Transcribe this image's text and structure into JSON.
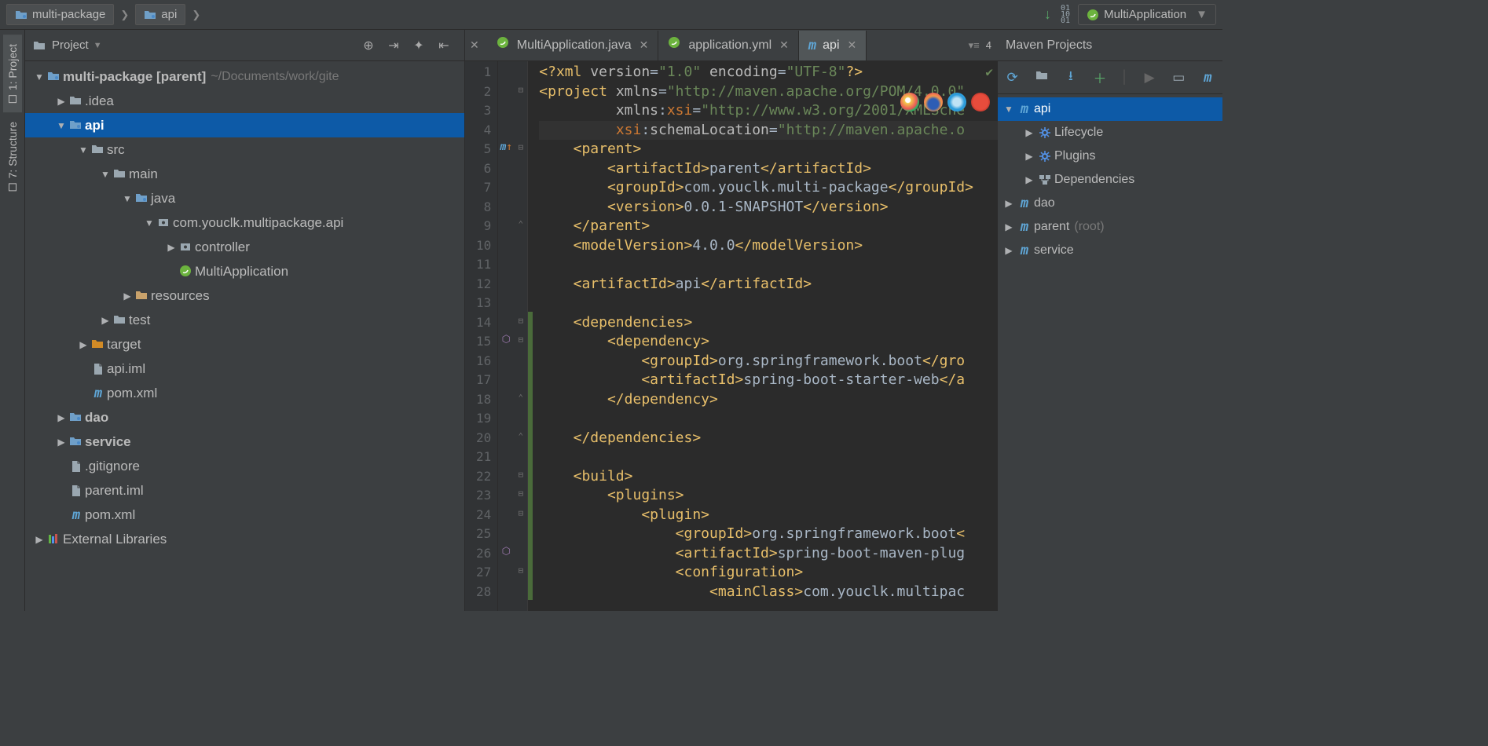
{
  "run_config": {
    "label": "MultiApplication"
  },
  "breadcrumb": [
    {
      "label": "multi-package"
    },
    {
      "label": "api"
    }
  ],
  "left_tabs": [
    {
      "label": "1: Project",
      "active": true
    },
    {
      "label": "7: Structure",
      "active": false
    }
  ],
  "project_panel": {
    "title": "Project",
    "tree": [
      {
        "d": 0,
        "tw": "down",
        "ico": "folder-blue",
        "label": "multi-package",
        "bold": true,
        "aux_label": " [parent]",
        "path": " ~/Documents/work/gite"
      },
      {
        "d": 1,
        "tw": "right",
        "ico": "folder",
        "label": ".idea"
      },
      {
        "d": 1,
        "tw": "down",
        "ico": "folder-blue",
        "label": "api",
        "bold": true,
        "sel": true
      },
      {
        "d": 2,
        "tw": "down",
        "ico": "folder",
        "label": "src"
      },
      {
        "d": 3,
        "tw": "down",
        "ico": "folder",
        "label": "main"
      },
      {
        "d": 4,
        "tw": "down",
        "ico": "folder-blue",
        "label": "java"
      },
      {
        "d": 5,
        "tw": "down",
        "ico": "package",
        "label": "com.youclk.multipackage.api"
      },
      {
        "d": 6,
        "tw": "right",
        "ico": "package",
        "label": "controller"
      },
      {
        "d": 6,
        "tw": "",
        "ico": "spring",
        "label": "MultiApplication"
      },
      {
        "d": 4,
        "tw": "right",
        "ico": "resources",
        "label": "resources"
      },
      {
        "d": 3,
        "tw": "right",
        "ico": "folder",
        "label": "test"
      },
      {
        "d": 2,
        "tw": "right",
        "ico": "folder-orange",
        "label": "target"
      },
      {
        "d": 2,
        "tw": "",
        "ico": "file",
        "label": "api.iml"
      },
      {
        "d": 2,
        "tw": "",
        "ico": "m",
        "label": "pom.xml"
      },
      {
        "d": 1,
        "tw": "right",
        "ico": "folder-blue",
        "label": "dao",
        "bold": true
      },
      {
        "d": 1,
        "tw": "right",
        "ico": "folder-blue",
        "label": "service",
        "bold": true
      },
      {
        "d": 1,
        "tw": "",
        "ico": "file",
        "label": ".gitignore"
      },
      {
        "d": 1,
        "tw": "",
        "ico": "file",
        "label": "parent.iml"
      },
      {
        "d": 1,
        "tw": "",
        "ico": "m",
        "label": "pom.xml"
      },
      {
        "d": 0,
        "tw": "right",
        "ico": "libs",
        "label": "External Libraries"
      }
    ]
  },
  "editor": {
    "tabs": [
      {
        "label": "MultiApplication.java",
        "ico": "spring",
        "active": false
      },
      {
        "label": "application.yml",
        "ico": "spring",
        "active": false
      },
      {
        "label": "api",
        "ico": "m",
        "active": true
      }
    ],
    "lines": 28,
    "breadcrumb_count": "4",
    "code_lines": [
      {
        "n": 1,
        "html": "<span class='pi'>&lt;?xml</span> <span class='n'>version</span><span class='p'>=</span><span class='s'>\"1.0\"</span> <span class='n'>encoding</span><span class='p'>=</span><span class='s'>\"UTF-8\"</span><span class='pi'>?&gt;</span>"
      },
      {
        "n": 2,
        "html": "<span class='a'>&lt;project</span> <span class='n'>xmlns</span><span class='p'>=</span><span class='s'>\"http://maven.apache.org/POM/4.0.0\"</span>"
      },
      {
        "n": 3,
        "html": "         <span class='n'>xmlns</span><span class='p'>:</span><span class='ns'>xsi</span><span class='p'>=</span><span class='s'>\"http://www.w3.org/2001/XMLSche</span>"
      },
      {
        "n": 4,
        "hl": true,
        "html": "         <span class='ns'>xsi</span><span class='p'>:</span><span class='n'>schemaLocation</span><span class='p'>=</span><span class='s'>\"http://maven.apache.o</span>"
      },
      {
        "n": 5,
        "html": "    <span class='a'>&lt;parent&gt;</span>"
      },
      {
        "n": 6,
        "html": "        <span class='a'>&lt;artifactId&gt;</span><span class='t'>parent</span><span class='a'>&lt;/artifactId&gt;</span>"
      },
      {
        "n": 7,
        "html": "        <span class='a'>&lt;groupId&gt;</span><span class='t'>com.youclk.multi-package</span><span class='a'>&lt;/groupId&gt;</span>"
      },
      {
        "n": 8,
        "html": "        <span class='a'>&lt;version&gt;</span><span class='t'>0.0.1-SNAPSHOT</span><span class='a'>&lt;/version&gt;</span>"
      },
      {
        "n": 9,
        "html": "    <span class='a'>&lt;/parent&gt;</span>"
      },
      {
        "n": 10,
        "html": "    <span class='a'>&lt;modelVersion&gt;</span><span class='t'>4.0.0</span><span class='a'>&lt;/modelVersion&gt;</span>"
      },
      {
        "n": 11,
        "html": ""
      },
      {
        "n": 12,
        "html": "    <span class='a'>&lt;artifactId&gt;</span><span class='t'>api</span><span class='a'>&lt;/artifactId&gt;</span>"
      },
      {
        "n": 13,
        "html": ""
      },
      {
        "n": 14,
        "html": "    <span class='a'>&lt;dependencies&gt;</span>"
      },
      {
        "n": 15,
        "html": "        <span class='a'>&lt;dependency&gt;</span>"
      },
      {
        "n": 16,
        "html": "            <span class='a'>&lt;groupId&gt;</span><span class='t'>org.springframework.boot</span><span class='a'>&lt;/gro</span>"
      },
      {
        "n": 17,
        "html": "            <span class='a'>&lt;artifactId&gt;</span><span class='t'>spring-boot-starter-web</span><span class='a'>&lt;/a</span>"
      },
      {
        "n": 18,
        "html": "        <span class='a'>&lt;/dependency&gt;</span>"
      },
      {
        "n": 19,
        "html": ""
      },
      {
        "n": 20,
        "html": "    <span class='a'>&lt;/dependencies&gt;</span>"
      },
      {
        "n": 21,
        "html": ""
      },
      {
        "n": 22,
        "html": "    <span class='a'>&lt;build&gt;</span>"
      },
      {
        "n": 23,
        "html": "        <span class='a'>&lt;plugins&gt;</span>"
      },
      {
        "n": 24,
        "html": "            <span class='a'>&lt;plugin&gt;</span>"
      },
      {
        "n": 25,
        "html": "                <span class='a'>&lt;groupId&gt;</span><span class='t'>org.springframework.boot</span><span class='a'>&lt;</span>"
      },
      {
        "n": 26,
        "html": "                <span class='a'>&lt;artifactId&gt;</span><span class='t'>spring-boot-maven-plug</span>"
      },
      {
        "n": 27,
        "html": "                <span class='a'>&lt;configuration&gt;</span>"
      },
      {
        "n": 28,
        "html": "                    <span class='a'>&lt;mainClass&gt;</span><span class='t'>com.youclk.multipac</span>"
      }
    ],
    "fold_markers": {
      "2": "-",
      "5": "-",
      "9": "up",
      "14": "-",
      "15": "-",
      "18": "up",
      "20": "up",
      "22": "-",
      "23": "-",
      "24": "-",
      "27": "-"
    },
    "gutter_icons": {
      "5": "m-up-orange",
      "15": "dep-up",
      "26": "dep-up"
    },
    "vcs_green_from": 14
  },
  "maven": {
    "title": "Maven Projects",
    "tree": [
      {
        "d": 0,
        "tw": "down",
        "ico": "m",
        "label": "api",
        "bold": true,
        "sel": true
      },
      {
        "d": 1,
        "tw": "right",
        "ico": "gear",
        "label": "Lifecycle"
      },
      {
        "d": 1,
        "tw": "right",
        "ico": "gear",
        "label": "Plugins"
      },
      {
        "d": 1,
        "tw": "right",
        "ico": "deps",
        "label": "Dependencies"
      },
      {
        "d": 0,
        "tw": "right",
        "ico": "m",
        "label": "dao",
        "bold": true
      },
      {
        "d": 0,
        "tw": "right",
        "ico": "m",
        "label": "parent",
        "bold": true,
        "aux": "(root)"
      },
      {
        "d": 0,
        "tw": "right",
        "ico": "m",
        "label": "service",
        "bold": true
      }
    ]
  },
  "colors": {
    "accent": "#0d5aa7",
    "tag": "#e8bf6a",
    "string": "#6a8759",
    "bg_editor": "#2b2b2b",
    "bg_panel": "#3c3f41"
  }
}
